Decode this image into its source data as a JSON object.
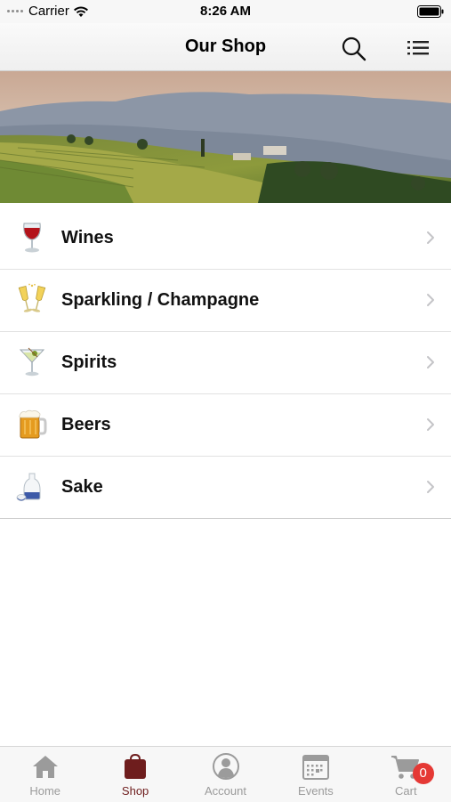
{
  "status_bar": {
    "carrier": "Carrier",
    "time": "8:26 AM"
  },
  "nav": {
    "title": "Our Shop"
  },
  "categories": [
    {
      "label": "Wines",
      "icon": "wine-glass-icon"
    },
    {
      "label": "Sparkling / Champagne",
      "icon": "champagne-glasses-icon"
    },
    {
      "label": "Spirits",
      "icon": "cocktail-glass-icon"
    },
    {
      "label": "Beers",
      "icon": "beer-mug-icon"
    },
    {
      "label": "Sake",
      "icon": "sake-bottle-icon"
    }
  ],
  "tabs": [
    {
      "label": "Home",
      "icon": "home-icon",
      "active": false
    },
    {
      "label": "Shop",
      "icon": "shopping-bag-icon",
      "active": true
    },
    {
      "label": "Account",
      "icon": "account-icon",
      "active": false
    },
    {
      "label": "Events",
      "icon": "calendar-icon",
      "active": false
    },
    {
      "label": "Cart",
      "icon": "cart-icon",
      "active": false
    }
  ],
  "cart": {
    "badge_count": "0"
  },
  "colors": {
    "accent": "#6e1d1d",
    "tab_inactive": "#9b9b9b",
    "badge": "#e53935"
  }
}
